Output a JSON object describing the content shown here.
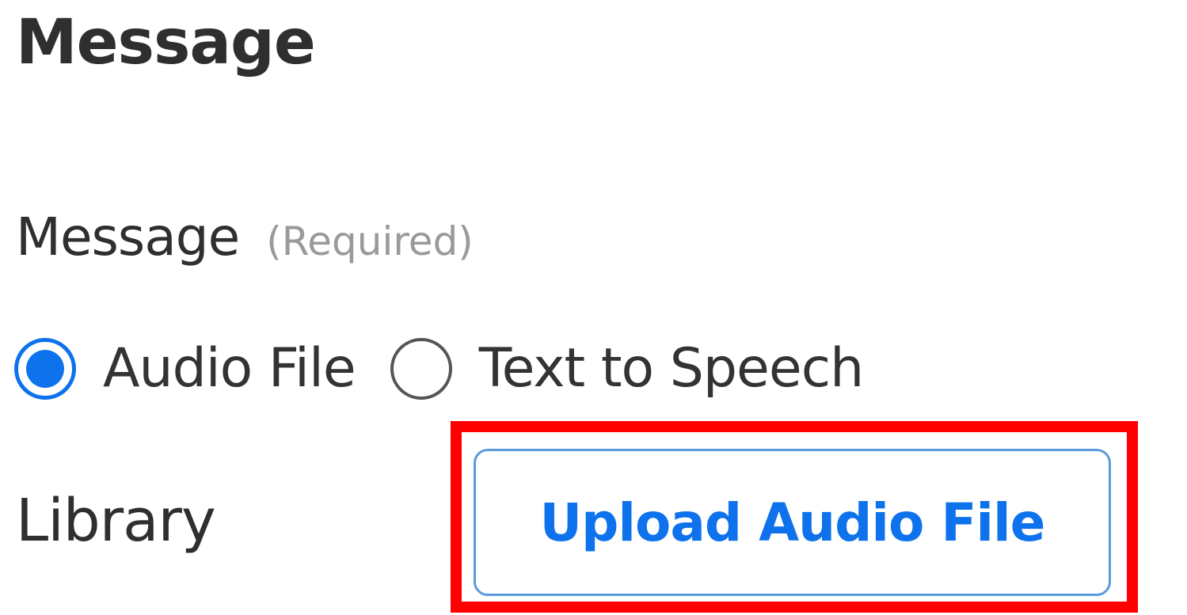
{
  "section": {
    "title": "Message"
  },
  "message_field": {
    "label": "Message",
    "required_hint": "(Required)",
    "options": [
      {
        "label": "Audio File",
        "selected": true
      },
      {
        "label": "Text to Speech",
        "selected": false
      }
    ]
  },
  "library": {
    "label": "Library",
    "upload_button_label": "Upload Audio File"
  },
  "colors": {
    "accent": "#0e72ed",
    "highlight": "#ff0000",
    "button_border": "#5b9bdc",
    "hint": "#9a9a9a",
    "text": "#333333"
  }
}
